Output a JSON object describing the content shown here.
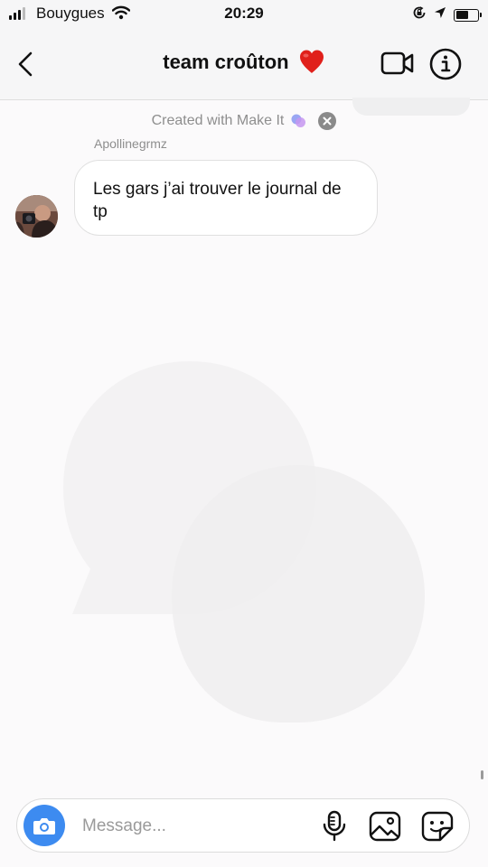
{
  "status_bar": {
    "carrier": "Bouygues",
    "time": "20:29",
    "signal_bars_active": 3,
    "battery_level": 0.55
  },
  "header": {
    "title": "team croûton",
    "back_icon": "chevron-left-icon",
    "video_icon": "video-camera-icon",
    "info_icon": "info-icon",
    "title_emoji": "red-heart-icon"
  },
  "banner": {
    "text": "Created with Make It",
    "close_icon": "close-icon"
  },
  "messages": [
    {
      "sender": "Apollinegrmz",
      "text": "Les gars j’ai trouver le journal de tp"
    }
  ],
  "composer": {
    "placeholder": "Message...",
    "value": "",
    "camera_icon": "camera-icon",
    "mic_icon": "microphone-icon",
    "gallery_icon": "gallery-icon",
    "sticker_icon": "sticker-icon"
  },
  "colors": {
    "accent": "#3d8bf0",
    "heart": "#e0201b",
    "muted_text": "#8e8e8e"
  }
}
